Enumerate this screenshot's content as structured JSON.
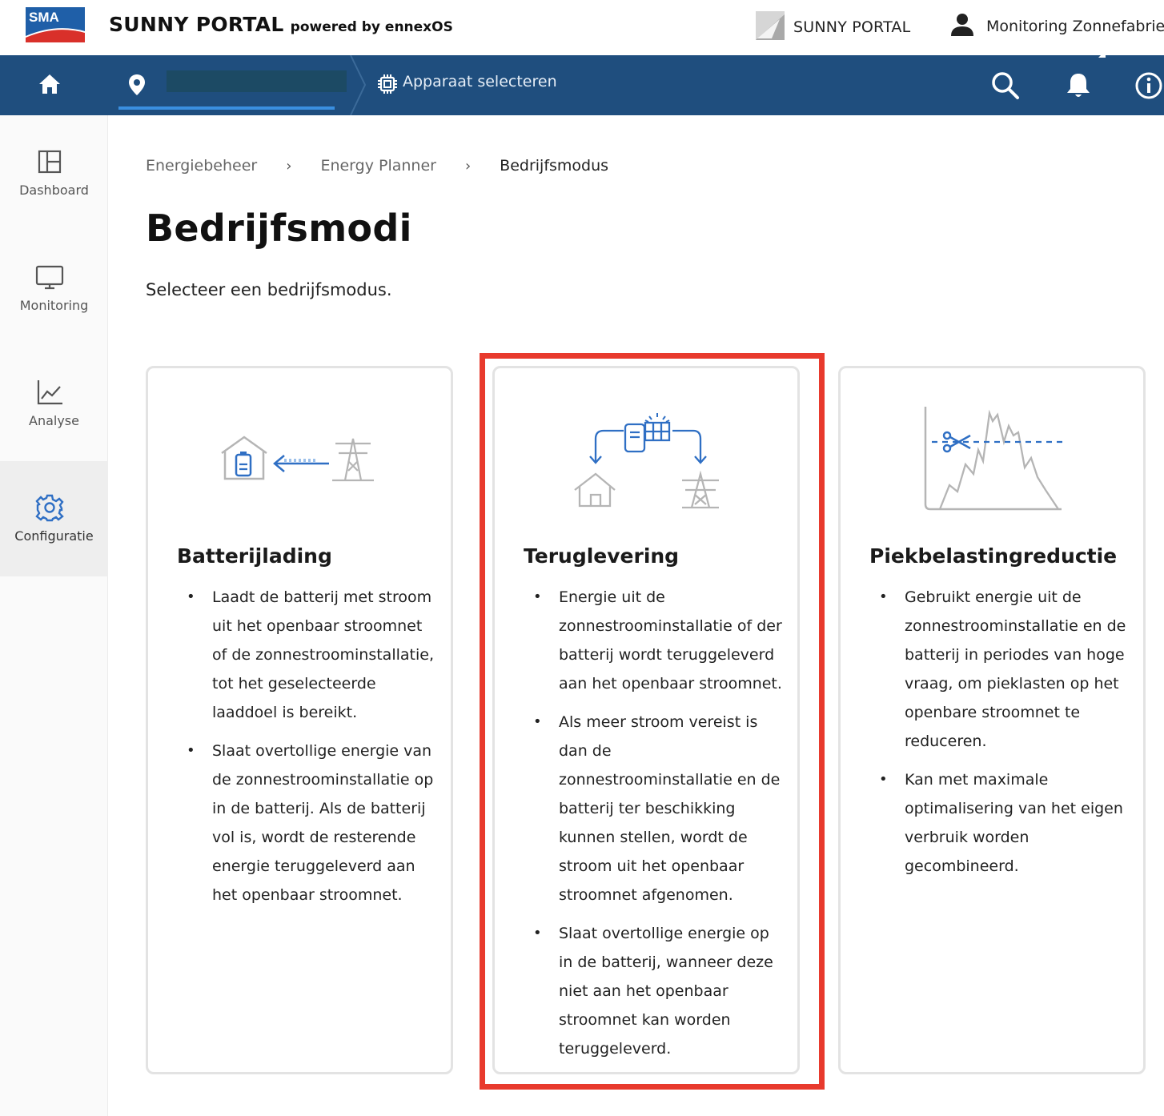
{
  "header": {
    "logo_text": "SMA",
    "brand": "SUNNY PORTAL",
    "brand_sub": "powered by ennexOS",
    "portal_link": "SUNNY PORTAL",
    "user_name": "Monitoring Zonnefabriek"
  },
  "navbar": {
    "site_name": ".",
    "device_label": "Apparaat selecteren"
  },
  "sidebar": {
    "items": [
      {
        "label": "Dashboard",
        "icon": "dashboard-icon"
      },
      {
        "label": "Monitoring",
        "icon": "monitor-icon"
      },
      {
        "label": "Analyse",
        "icon": "chart-icon"
      },
      {
        "label": "Configuratie",
        "icon": "gear-icon",
        "active": true
      }
    ]
  },
  "breadcrumb": [
    "Energiebeheer",
    "Energy Planner",
    "Bedrijfsmodus"
  ],
  "page": {
    "title": "Bedrijfsmodi",
    "subtitle": "Selecteer een bedrijfsmodus."
  },
  "cards": [
    {
      "title": "Batterijlading",
      "icon": "battery-charging-illustration",
      "bullets": [
        "Laadt de batterij met stroom uit het openbaar stroomnet of de zonnestroominstallatie, tot het geselecteerde laaddoel is bereikt.",
        "Slaat overtollige energie van de zonnestroominstallatie op in de batterij. Als de batterij vol is, wordt de resterende energie teruggeleverd aan het openbaar stroomnet."
      ]
    },
    {
      "title": "Teruglevering",
      "icon": "feed-in-illustration",
      "highlighted": true,
      "bullets": [
        "Energie uit de zonnestroominstallatie of der batterij wordt teruggeleverd aan het openbaar stroomnet.",
        "Als meer stroom vereist is dan de zonnestroominstallatie en de batterij ter beschikking kunnen stellen, wordt de stroom uit het openbaar stroomnet afgenomen.",
        "Slaat overtollige energie op in de batterij, wanneer deze niet aan het openbaar stroomnet kan worden teruggeleverd."
      ]
    },
    {
      "title": "Piekbelastingreductie",
      "icon": "peak-shaving-illustration",
      "bullets": [
        "Gebruikt energie uit de zonnestroominstallatie en de batterij in periodes van hoge vraag, om pieklasten op het openbare stroomnet te reduceren.",
        "Kan met maximale optimalisering van het eigen verbruik worden gecombineerd."
      ]
    }
  ],
  "colors": {
    "navbar": "#1f4e7e",
    "accent_blue": "#2f6fc4",
    "highlight_red": "#e83a2d",
    "logo_blue": "#1f5fa8",
    "logo_red": "#d9302a"
  }
}
